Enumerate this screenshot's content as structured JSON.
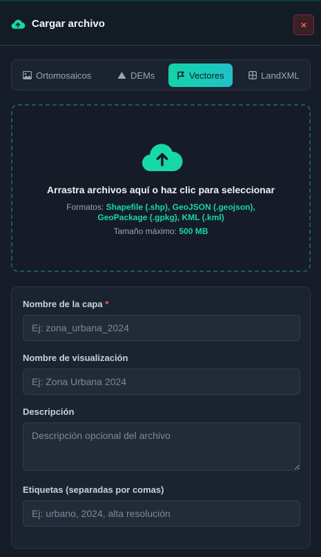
{
  "header": {
    "title": "Cargar archivo",
    "close_label": "×"
  },
  "tabs": [
    {
      "label": "Ortomosaicos",
      "icon": "image-icon"
    },
    {
      "label": "DEMs",
      "icon": "mountain-icon"
    },
    {
      "label": "Vectores",
      "icon": "vector-icon",
      "active": true
    },
    {
      "label": "LandXML",
      "icon": "grid-icon"
    }
  ],
  "dropzone": {
    "title": "Arrastra archivos aquí o haz clic para seleccionar",
    "formats_label": "Formatos:",
    "formats_line1": "Shapefile (.shp), GeoJSON (.geojson),",
    "formats_line2": "GeoPackage (.gpkg), KML (.kml)",
    "max_size_label": "Tamaño máximo:",
    "max_size_value": "500 MB"
  },
  "form": {
    "layer_name_label": "Nombre de la capa",
    "required_mark": "*",
    "layer_name_placeholder": "Ej: zona_urbana_2024",
    "display_name_label": "Nombre de visualización",
    "display_name_placeholder": "Ej: Zona Urbana 2024",
    "description_label": "Descripción",
    "description_placeholder": "Descripción opcional del archivo",
    "tags_label": "Etiquetas (separadas por comas)",
    "tags_placeholder": "Ej: urbano, 2024, alta resolución"
  },
  "colors": {
    "accent": "#17d8a6",
    "danger": "#ff5b5b",
    "background": "#161d28"
  }
}
